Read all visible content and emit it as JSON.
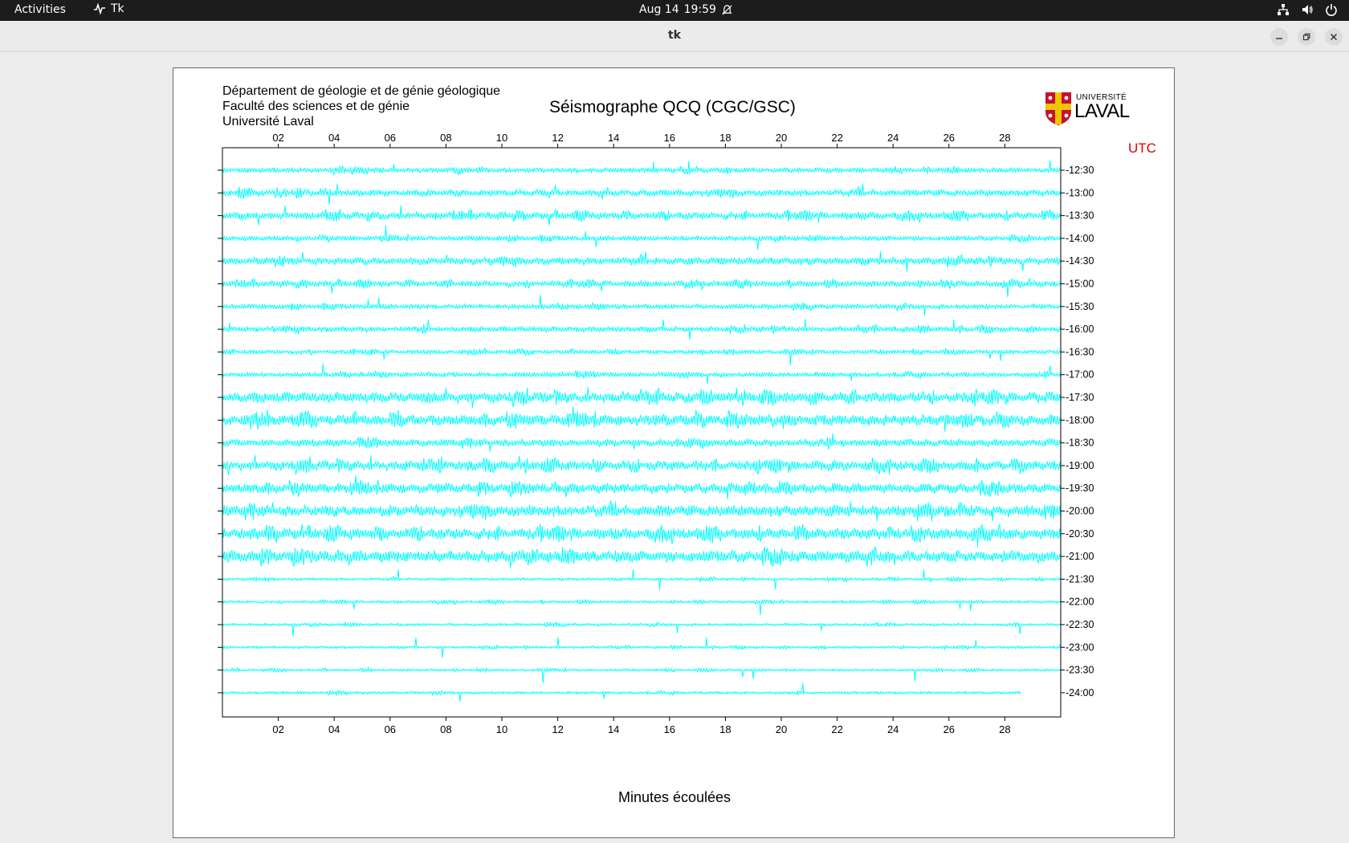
{
  "topbar": {
    "activities": "Activities",
    "app_name": "Tk",
    "date": "Aug 14",
    "time": "19:59",
    "icons": [
      "network-icon",
      "volume-icon",
      "power-icon"
    ]
  },
  "window": {
    "title": "tk"
  },
  "header": {
    "line1": "Département de géologie et de génie géologique",
    "line2": "Faculté des sciences et de génie",
    "line3": "Université Laval",
    "title": "Séismographe QCQ (CGC/GSC)",
    "logo_top": "UNIVERSITÉ",
    "logo_main": "LAVAL"
  },
  "chart_data": {
    "type": "line",
    "xlabel": "Minutes écoulées",
    "x_ticks": [
      "02",
      "04",
      "06",
      "08",
      "10",
      "12",
      "14",
      "16",
      "18",
      "20",
      "22",
      "24",
      "26",
      "28"
    ],
    "xlim": [
      0,
      30
    ],
    "time_unit_label": "UTC",
    "trace_color": "#00ffff",
    "rows": [
      {
        "label": "12:30",
        "amplitude": 0.35,
        "end_minute": 30
      },
      {
        "label": "13:00",
        "amplitude": 0.5,
        "end_minute": 30
      },
      {
        "label": "13:30",
        "amplitude": 0.55,
        "end_minute": 30
      },
      {
        "label": "14:00",
        "amplitude": 0.35,
        "end_minute": 30
      },
      {
        "label": "14:30",
        "amplitude": 0.55,
        "end_minute": 30
      },
      {
        "label": "15:00",
        "amplitude": 0.45,
        "end_minute": 30
      },
      {
        "label": "15:30",
        "amplitude": 0.35,
        "end_minute": 30
      },
      {
        "label": "16:00",
        "amplitude": 0.4,
        "end_minute": 30
      },
      {
        "label": "16:30",
        "amplitude": 0.3,
        "end_minute": 30
      },
      {
        "label": "17:00",
        "amplitude": 0.35,
        "end_minute": 30
      },
      {
        "label": "17:30",
        "amplitude": 0.8,
        "end_minute": 30
      },
      {
        "label": "18:00",
        "amplitude": 0.85,
        "end_minute": 30
      },
      {
        "label": "18:30",
        "amplitude": 0.55,
        "end_minute": 30
      },
      {
        "label": "19:00",
        "amplitude": 0.75,
        "end_minute": 30
      },
      {
        "label": "19:30",
        "amplitude": 0.75,
        "end_minute": 30
      },
      {
        "label": "20:00",
        "amplitude": 0.85,
        "end_minute": 30
      },
      {
        "label": "20:30",
        "amplitude": 0.85,
        "end_minute": 30
      },
      {
        "label": "21:00",
        "amplitude": 0.9,
        "end_minute": 30
      },
      {
        "label": "21:30",
        "amplitude": 0.2,
        "end_minute": 30
      },
      {
        "label": "22:00",
        "amplitude": 0.2,
        "end_minute": 30
      },
      {
        "label": "22:30",
        "amplitude": 0.2,
        "end_minute": 30
      },
      {
        "label": "23:00",
        "amplitude": 0.18,
        "end_minute": 30
      },
      {
        "label": "23:30",
        "amplitude": 0.18,
        "end_minute": 30
      },
      {
        "label": "24:00",
        "amplitude": 0.2,
        "end_minute": 28.6
      }
    ]
  }
}
